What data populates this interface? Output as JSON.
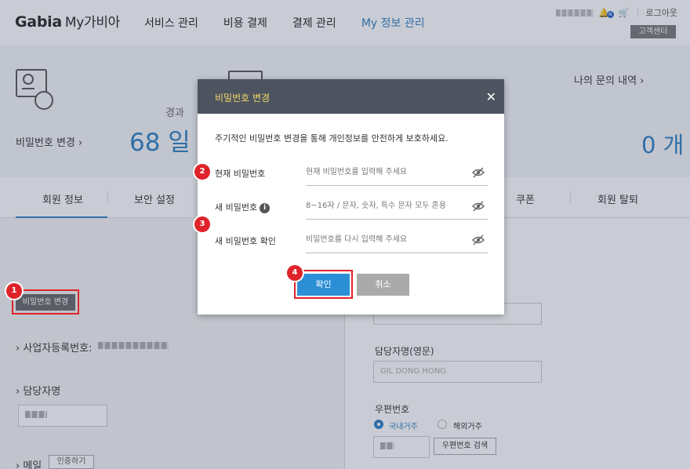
{
  "header": {
    "logo": "Gabia",
    "logo_sub": "My가비아",
    "nav": [
      "서비스 관리",
      "비용 결제",
      "결제 관리",
      "My 정보 관리"
    ],
    "logout": "로그아웃",
    "customer_center": "고객센터",
    "notification_count": "N"
  },
  "summary": {
    "password_change_link": "비밀번호 변경",
    "elapsed_label": "경과",
    "elapsed_days": "68 일",
    "inquiry_link": "나의 문의 내역",
    "inquiry_count": "0 개"
  },
  "tabs": [
    "회원 정보",
    "보안 설정",
    "쿠폰",
    "회원 탈퇴"
  ],
  "left": {
    "password_change_button": "비밀번호 변경",
    "business_number_label": "사업자등록번호:",
    "manager_label": "담당자명",
    "email_label": "메일",
    "verify_button": "인증하기"
  },
  "right": {
    "manager_en_label": "담당자명(영문)",
    "manager_en_value": "GIL DONG HONG",
    "zip_label": "우편번호",
    "radio_domestic": "국내거주",
    "radio_overseas": "해외거주",
    "zip_search_button": "우편번호 검색"
  },
  "modal": {
    "title": "비밀번호 변경",
    "close": "✕",
    "description": "주기적인 비밀번호 변경을 통해 개인정보를 안전하게 보호하세요.",
    "current_label": "현재 비밀번호",
    "current_placeholder": "현재 비밀번호를 입력해 주세요",
    "new_label": "새 비밀번호",
    "new_placeholder": "8~16자 / 문자, 숫자, 특수 문자 모두 혼용",
    "confirm_label": "새 비밀번호 확인",
    "confirm_placeholder": "비밀번호를 다시 입력해 주세요",
    "ok_button": "확인",
    "cancel_button": "취소"
  },
  "steps": [
    "1",
    "2",
    "3",
    "4"
  ],
  "colors": {
    "accent": "#2b7fc2",
    "modal_header": "#4d535f",
    "modal_title": "#f2d96b",
    "highlight": "#e0232a",
    "ok_button": "#2b8fd6",
    "cancel_button": "#aaaaaa"
  }
}
